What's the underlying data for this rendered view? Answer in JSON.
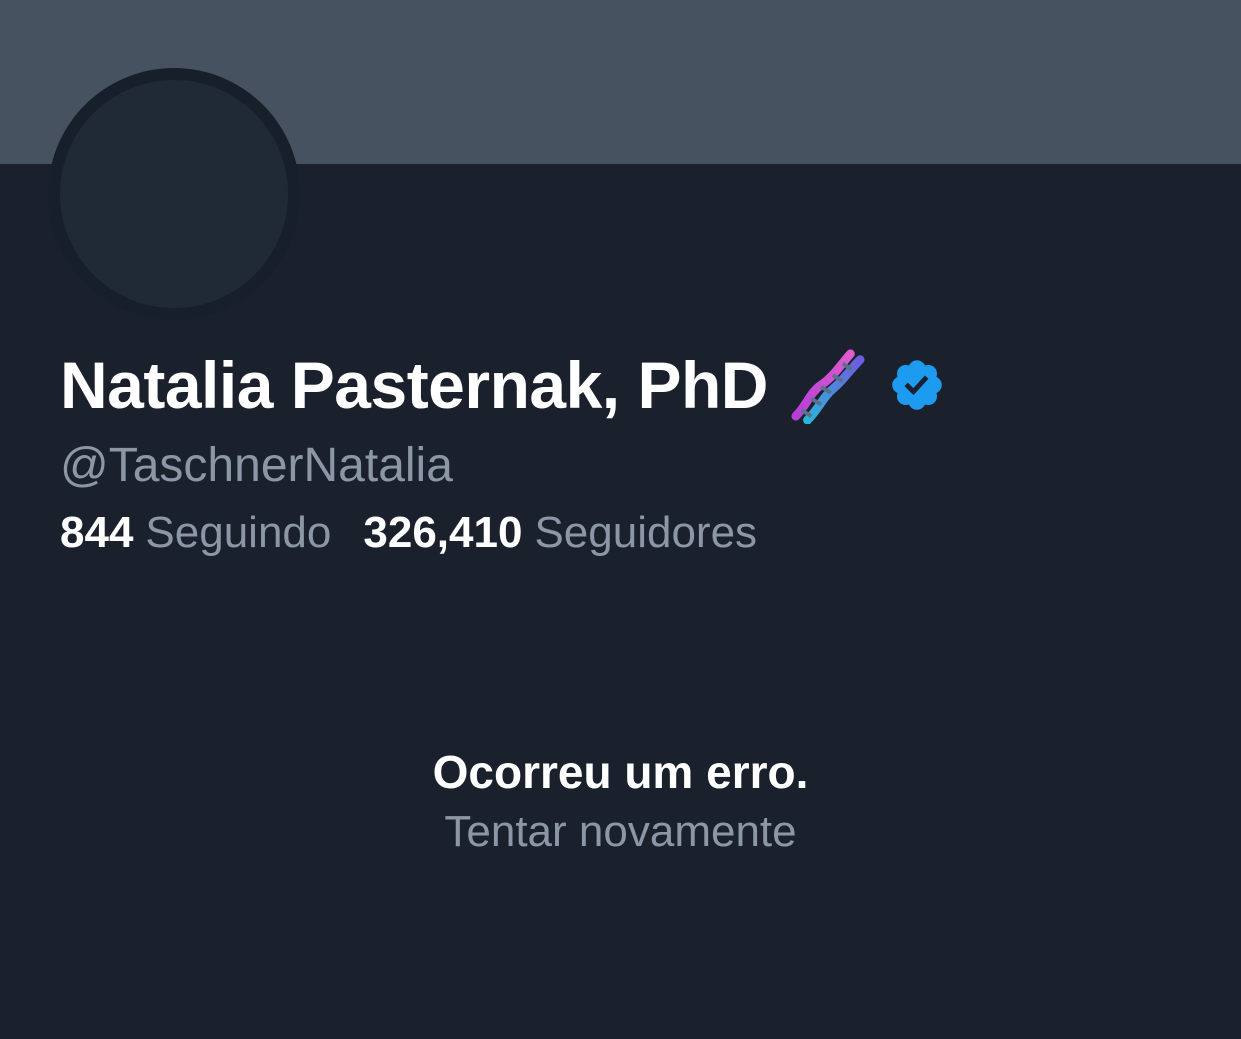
{
  "profile": {
    "display_name": "Natalia Pasternak, PhD",
    "name_emoji_icon": "dna-icon",
    "verified_icon": "verified-badge-icon",
    "handle": "@TaschnerNatalia"
  },
  "stats": {
    "following_count": "844",
    "following_label": "Seguindo",
    "followers_count": "326,410",
    "followers_label": "Seguidores"
  },
  "error": {
    "title": "Ocorreu um erro.",
    "retry_label": "Tentar novamente"
  },
  "colors": {
    "background": "#1b212c",
    "banner": "#46525f",
    "verified": "#1d9bf0",
    "secondary_text": "#8b97a4"
  }
}
